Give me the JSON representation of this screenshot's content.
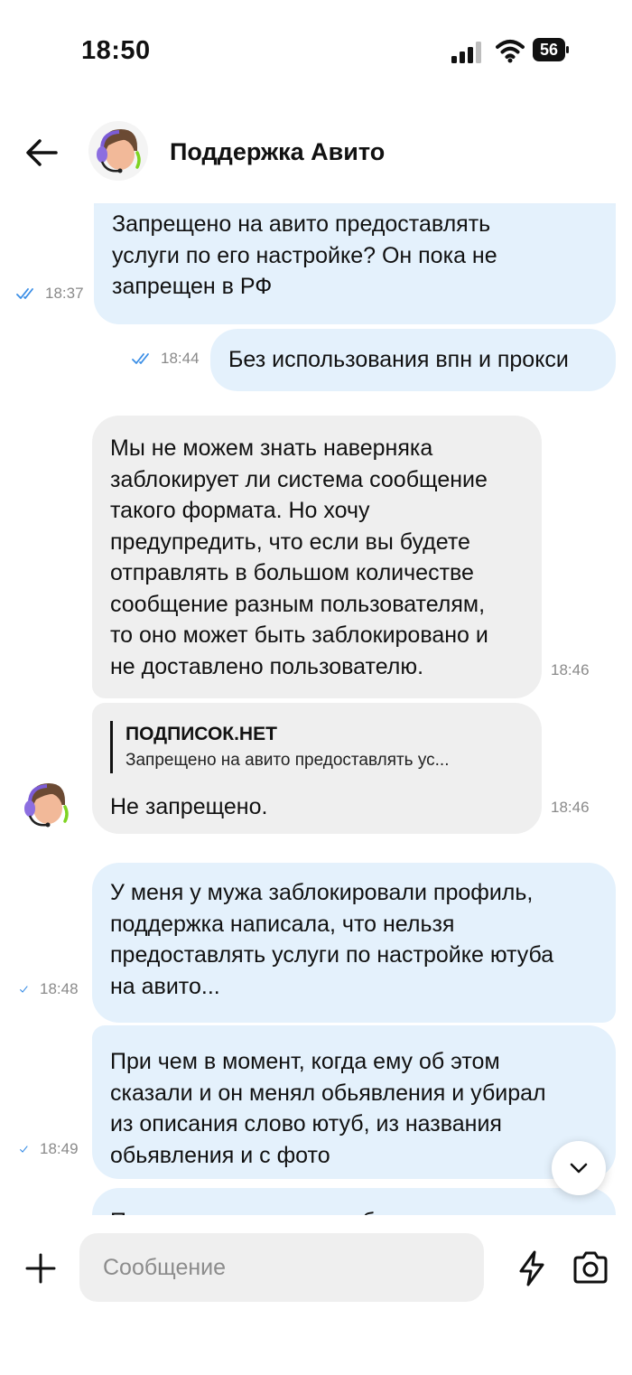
{
  "status_bar": {
    "time": "18:50",
    "battery": "56"
  },
  "header": {
    "title": "Поддержка Авито"
  },
  "messages": [
    {
      "text": "Запрещено на авито предоставлять\nуслуги по его настройке? Он пока не\nзапрещен в РФ",
      "time": "18:37"
    },
    {
      "text": "Без использования впн и прокси",
      "time": "18:44"
    },
    {
      "text": "Мы не можем знать наверняка\nзаблокирует ли система сообщение\nтакого формата. Но хочу\nпредупредить, что если вы будете\nотправлять в большом количестве\nсообщение разным пользователям,\nто оно может быть заблокировано и\nне доставлено пользователю.",
      "time": "18:46"
    },
    {
      "reply_title": "ПОДПИСОК.НЕТ",
      "reply_snippet": "Запрещено на авито предоставлять ус...",
      "text": "Не запрещено.",
      "time": "18:46"
    },
    {
      "text": "У меня у мужа заблокировали профиль,\nподдержка написала, что нельзя\nпредоставлять услуги по настройке ютуба\nна авито...",
      "time": "18:48"
    },
    {
      "text": "При чем в момент, когда ему об этом\nсказали и он менял обьявления и убирал\nиз описания слово ютуб, из названия\nобьявления и с фото",
      "time": "18:49"
    },
    {
      "text": "Получается что его ошибочно"
    }
  ],
  "composer": {
    "placeholder": "Сообщение"
  },
  "colors": {
    "outgoing_bubble": "#e4f1fc",
    "incoming_bubble": "#efefef",
    "check_blue": "#3a8ee6"
  }
}
